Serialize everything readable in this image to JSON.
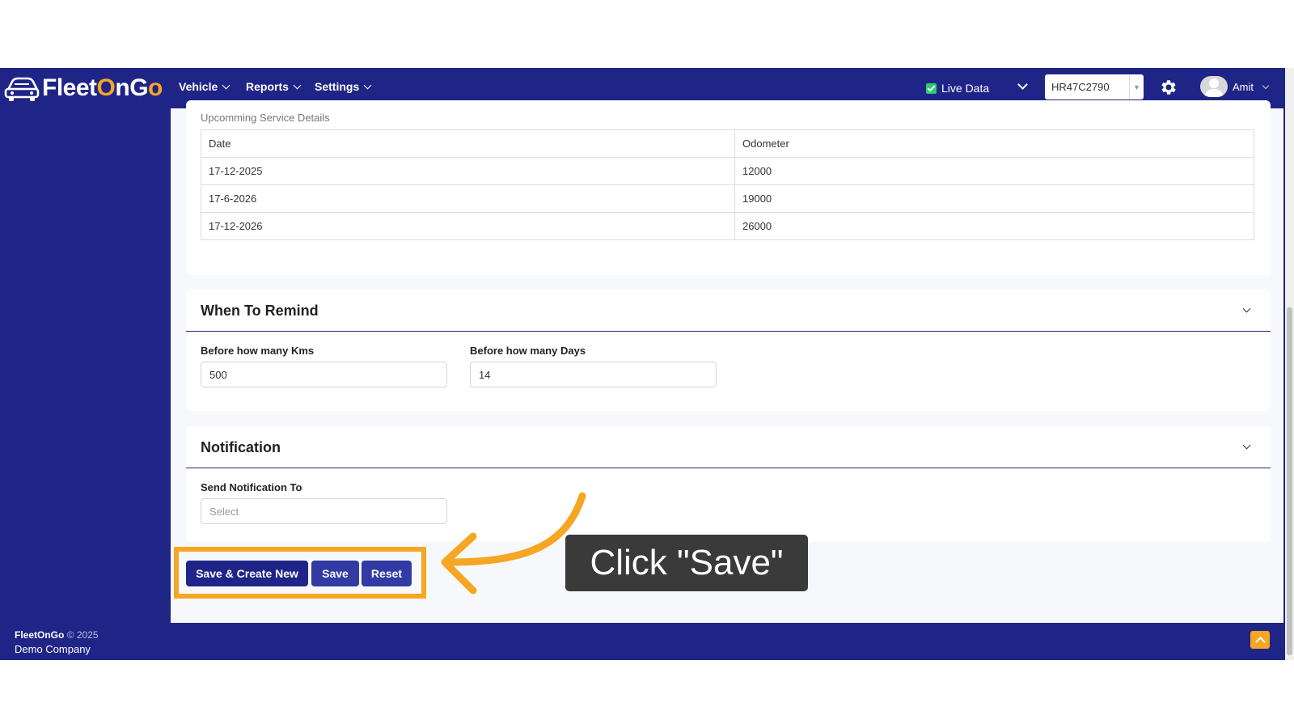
{
  "brand": {
    "name_part1": "Fleet",
    "name_o": "O",
    "name_part2": "nG",
    "name_o2": "o"
  },
  "nav": {
    "items": [
      {
        "label": "Vehicle"
      },
      {
        "label": "Reports"
      },
      {
        "label": "Settings"
      }
    ],
    "live_data_label": "Live Data",
    "vehicle_selected": "HR47C2790",
    "user_name": "Amit"
  },
  "service": {
    "title": "Upcomming Service Details",
    "headers": [
      "Date",
      "Odometer"
    ],
    "rows": [
      {
        "date": "17-12-2025",
        "odometer": "12000"
      },
      {
        "date": "17-6-2026",
        "odometer": "19000"
      },
      {
        "date": "17-12-2026",
        "odometer": "26000"
      }
    ]
  },
  "remind": {
    "title": "When To Remind",
    "kms_label": "Before how many Kms",
    "kms_value": "500",
    "days_label": "Before how many Days",
    "days_value": "14"
  },
  "notification": {
    "title": "Notification",
    "send_to_label": "Send Notification To",
    "send_to_placeholder": "Select"
  },
  "actions": {
    "save_create_new": "Save & Create New",
    "save": "Save",
    "reset": "Reset"
  },
  "annotation": {
    "callout": "Click \"Save\"",
    "color": "#f5a623"
  },
  "footer": {
    "brand": "FleetOnGo",
    "copyright": "© 2025",
    "company": "Demo Company"
  },
  "colors": {
    "navy": "#1f2587",
    "accent": "#f5a623",
    "live_check": "#2ecc71"
  }
}
